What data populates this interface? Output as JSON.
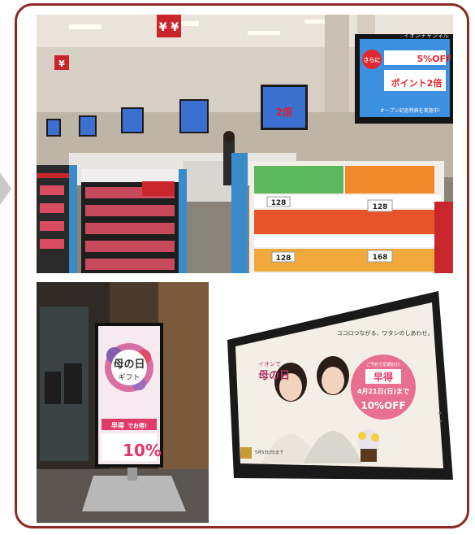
{
  "photos": [
    {
      "id": "checkout-area-photo",
      "signs": {
        "top_banner": "¥ ¥",
        "wall_monitor_channel": "イオンチャンネル"
      },
      "wall_monitor": {
        "badge": "さらに",
        "line1": "5%OFF",
        "line2": "ポイント2倍",
        "footer": "オープン記念特典を実施中!"
      },
      "shelf_prices": [
        "128",
        "128",
        "128",
        "168"
      ]
    },
    {
      "id": "vertical-signage-photo",
      "screen": {
        "title": "母の日",
        "subtitle": "ギフト",
        "badge": "早得",
        "promo": "でお得!",
        "discount": "10%"
      }
    },
    {
      "id": "monitor-photo",
      "screen": {
        "tagline": "ココロつながる、ワタシのしあわせ。",
        "event_pre": "イオンで",
        "event": "母の日",
        "badge_small": "ご予約で早期割引!",
        "badge_title": "早得",
        "date": "4月21日(日)まで",
        "discount": "10%OFF",
        "footer": "5月5日(日)まで"
      }
    }
  ]
}
